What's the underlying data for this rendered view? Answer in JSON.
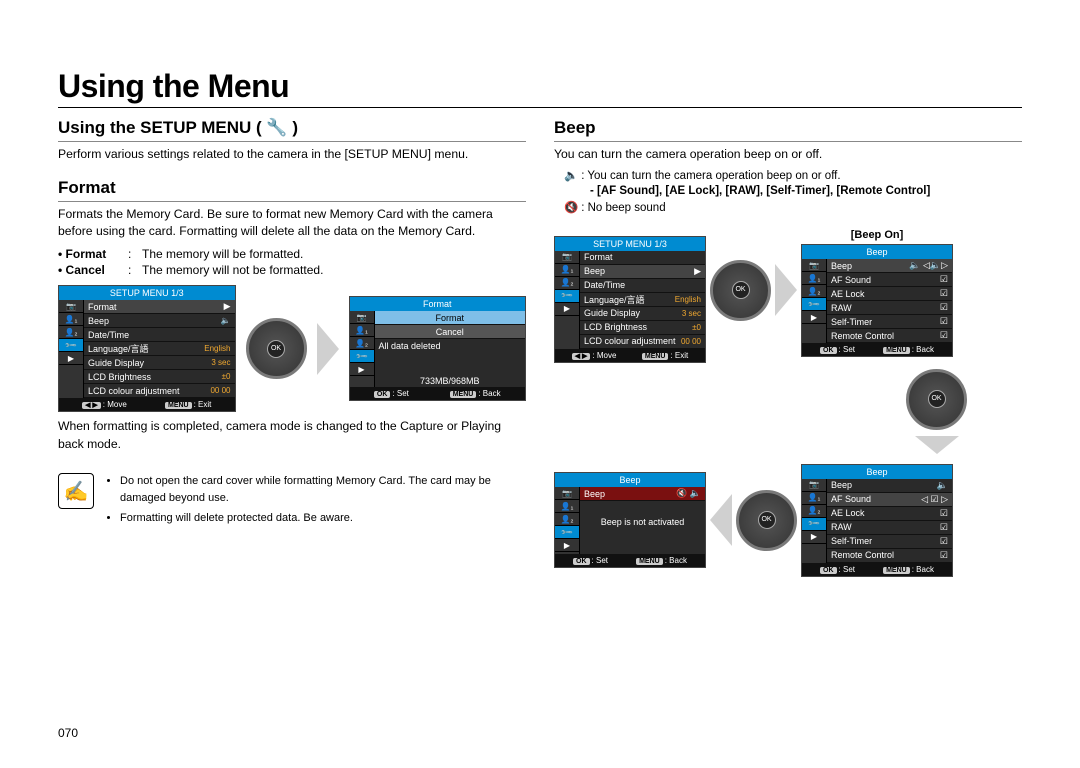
{
  "page_number": "070",
  "main_title": "Using the Menu",
  "left": {
    "section_title": "Using the SETUP MENU ( 🔧 )",
    "intro": "Perform various settings related to the camera in the [SETUP MENU] menu.",
    "sub_title": "Format",
    "sub_intro": "Formats the Memory Card. Be sure to format new Memory Card with the camera before using the card. Formatting will delete all the data on the Memory Card.",
    "defs": [
      {
        "term": "• Format",
        "sep": ":",
        "desc": "The memory will be formatted."
      },
      {
        "term": "• Cancel",
        "sep": ":",
        "desc": "The memory will not be formatted."
      }
    ],
    "lcd1": {
      "title": "SETUP MENU       1/3",
      "items": [
        {
          "label": "Format",
          "val": "▶",
          "hi": true
        },
        {
          "label": "Beep",
          "val": "🔈"
        },
        {
          "label": "Date/Time",
          "val": ""
        },
        {
          "label": "Language/言語",
          "val": "English"
        },
        {
          "label": "Guide Display",
          "val": "3 sec"
        },
        {
          "label": "LCD Brightness",
          "val": "±0"
        },
        {
          "label": "LCD colour adjustment",
          "val": "00 00"
        }
      ],
      "foot_left": ": Move",
      "foot_right": ": Exit"
    },
    "lcd2": {
      "title": "Format",
      "options": [
        "Format",
        "Cancel"
      ],
      "msg1": "All data deleted",
      "msg2": "733MB/968MB",
      "foot_left": ": Set",
      "foot_right": ": Back"
    },
    "after_text": "When formatting is completed, camera mode is changed to the Capture or Playing back mode.",
    "notes": [
      "Do not open the card cover while formatting Memory Card. The card may be damaged beyond use.",
      "Formatting will delete protected data. Be aware."
    ]
  },
  "right": {
    "section_title": "Beep",
    "intro": "You can turn the camera operation beep on or off.",
    "icon_on": "🔈",
    "icon_off": "🔇",
    "legend_on": "You can turn the camera operation beep on or off.",
    "legend_sub": "- [AF Sound], [AE Lock], [RAW], [Self-Timer], [Remote Control]",
    "legend_off": "No beep sound",
    "beep_on_label": "[Beep On]",
    "lcd_setup": {
      "title": "SETUP MENU       1/3",
      "items": [
        {
          "label": "Format",
          "val": ""
        },
        {
          "label": "Beep",
          "val": "▶",
          "hi": true
        },
        {
          "label": "Date/Time",
          "val": ""
        },
        {
          "label": "Language/言語",
          "val": "English"
        },
        {
          "label": "Guide Display",
          "val": "3 sec"
        },
        {
          "label": "LCD Brightness",
          "val": "±0"
        },
        {
          "label": "LCD colour adjustment",
          "val": "00 00"
        }
      ],
      "foot_left": ": Move",
      "foot_right": ": Exit"
    },
    "lcd_beep_on": {
      "title": "Beep",
      "items": [
        {
          "label": "Beep",
          "val": "🔈 ◁🔈▷",
          "hi": true
        },
        {
          "label": "AF Sound",
          "val": "☑"
        },
        {
          "label": "AE Lock",
          "val": "☑"
        },
        {
          "label": "RAW",
          "val": "☑"
        },
        {
          "label": "Self-Timer",
          "val": "☑"
        },
        {
          "label": "Remote Control",
          "val": "☑"
        }
      ],
      "foot_left": ": Set",
      "foot_right": ": Back"
    },
    "lcd_beep_off_msg": {
      "title": "Beep",
      "header_row": {
        "label": "Beep",
        "val": "🔇 🔈"
      },
      "msg": "Beep is not activated",
      "foot_left": ": Set",
      "foot_right": ": Back"
    },
    "lcd_beep_on2": {
      "title": "Beep",
      "items": [
        {
          "label": "Beep",
          "val": "🔈"
        },
        {
          "label": "AF Sound",
          "val": "◁ ☑ ▷",
          "hi": true
        },
        {
          "label": "AE Lock",
          "val": "☑"
        },
        {
          "label": "RAW",
          "val": "☑"
        },
        {
          "label": "Self-Timer",
          "val": "☑"
        },
        {
          "label": "Remote Control",
          "val": "☑"
        }
      ],
      "foot_left": ": Set",
      "foot_right": ": Back"
    },
    "foot_menu_label": "MENU",
    "foot_ok_label": "OK"
  }
}
